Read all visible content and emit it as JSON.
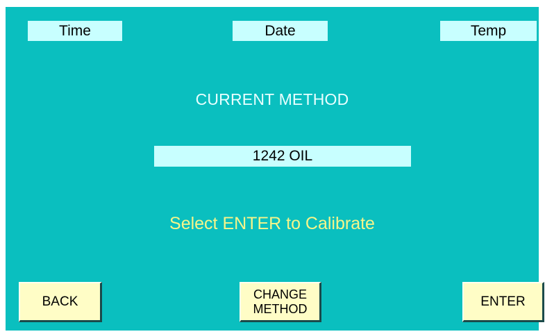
{
  "header": {
    "time_label": "Time",
    "date_label": "Date",
    "temp_label": "Temp"
  },
  "main": {
    "heading": "CURRENT METHOD",
    "current_method": "1242 OIL",
    "prompt": "Select ENTER to Calibrate"
  },
  "buttons": {
    "back_label": "BACK",
    "change_method_label": "CHANGE\nMETHOD",
    "enter_label": "ENTER"
  },
  "colors": {
    "background": "#0abfbf",
    "field_fill": "#c8ffff",
    "button_fill": "#fffdc6",
    "prompt_text": "#f6f58a",
    "heading_text": "#e8ffff"
  }
}
